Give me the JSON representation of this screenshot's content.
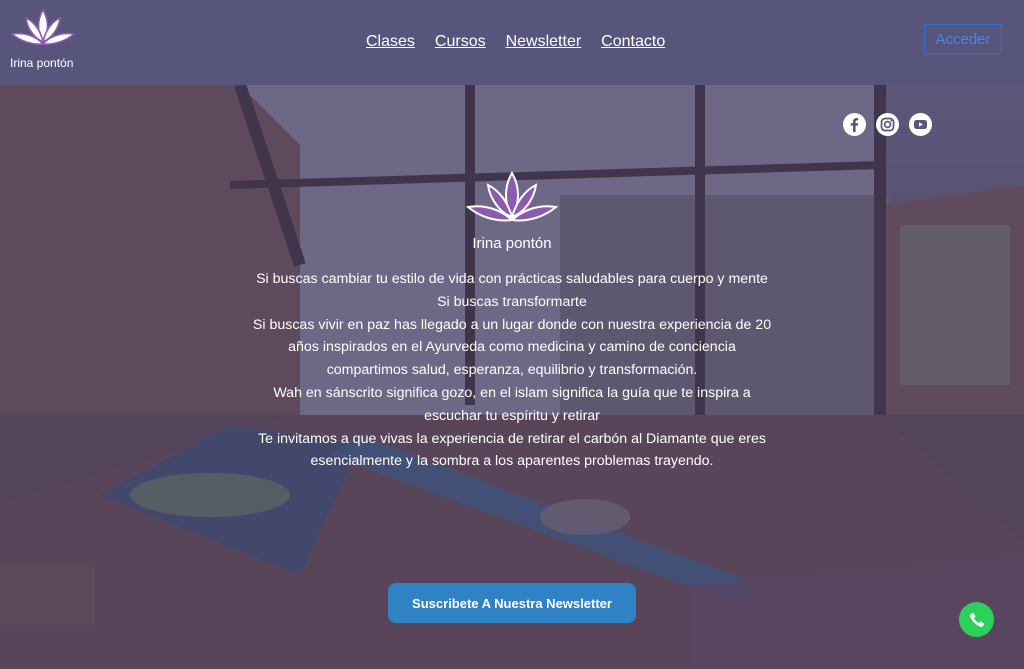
{
  "header": {
    "brand_name": "Irina pontón",
    "nav": [
      "Clases",
      "Cursos",
      "Newsletter",
      "Contacto"
    ],
    "login_label": "Acceder"
  },
  "socials": [
    "facebook-icon",
    "instagram-icon",
    "youtube-icon"
  ],
  "hero": {
    "name": "Irina pontón",
    "paragraphs": [
      "Si buscas cambiar tu estilo de vida con prácticas saludables para cuerpo y mente",
      "Si buscas transformarte",
      "Si buscas vivir en paz has llegado a un lugar donde con nuestra experiencia de 20 años inspirados en el Ayurveda como medicina y camino de conciencia compartimos salud, esperanza, equilibrio y transformación.",
      "Wah en sánscrito significa gozo, en el islam significa la guía que te inspira a escuchar tu espíritu y retirar",
      "Te invitamos a que vivas la experiencia de retirar el carbón al Diamante que eres esencialmente y la sombra a los aparentes problemas trayendo."
    ],
    "cta_label": "Suscribete A Nuestra Newsletter"
  },
  "colors": {
    "header_bg": "#57557c",
    "lotus": "#8a5bb0",
    "cta_bg": "#2f82c4",
    "whatsapp_bg": "#2bd15a",
    "login_border": "#2f6fd6"
  }
}
